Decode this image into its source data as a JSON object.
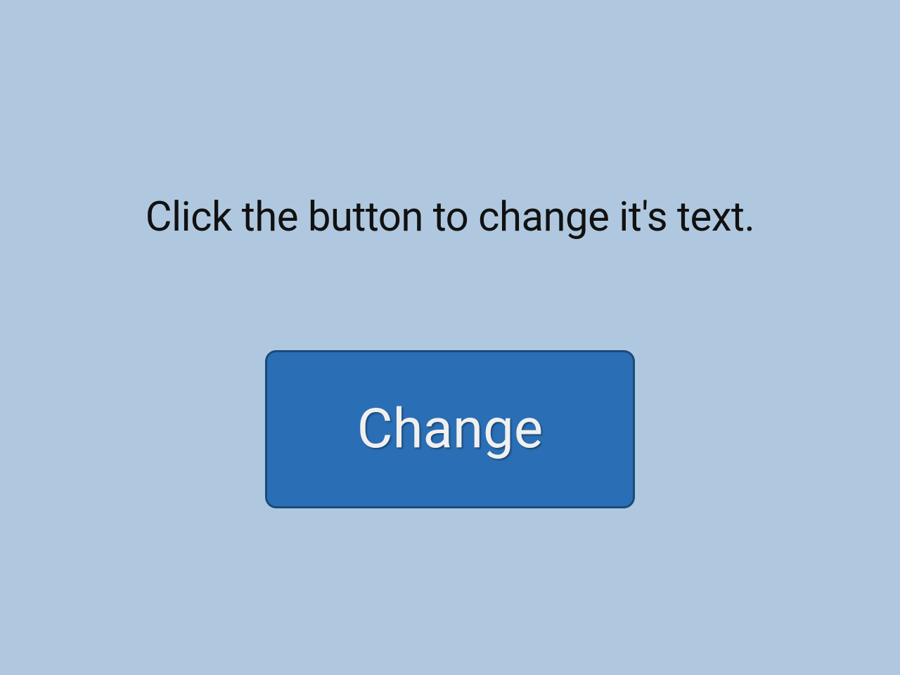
{
  "instruction_text": "Click the button to change it's text.",
  "button_label": "Change",
  "colors": {
    "background": "#b0c8df",
    "button_bg": "#2a6fb5",
    "button_border": "#1a4a7a",
    "button_text": "#f0f0f0",
    "instruction_text": "#111111"
  }
}
